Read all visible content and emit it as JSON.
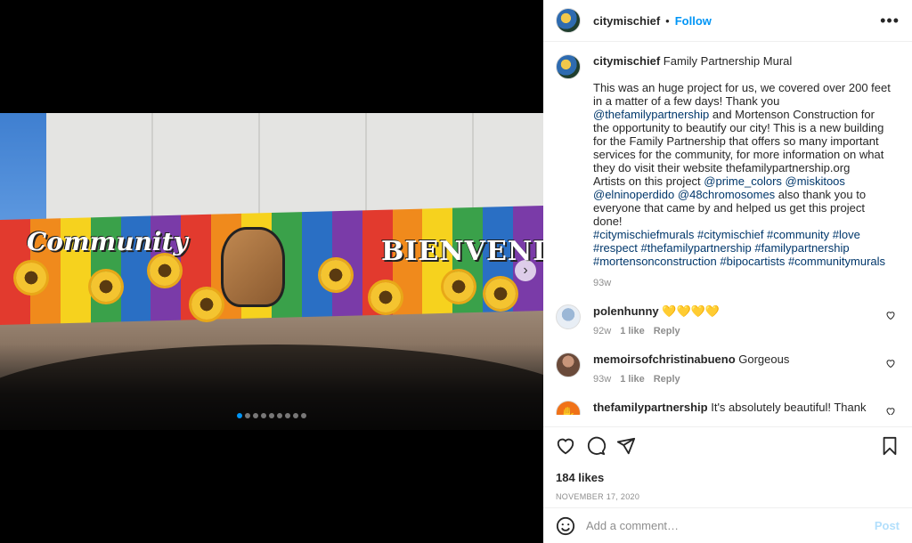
{
  "post": {
    "username": "citymischief",
    "separator": "•",
    "follow_label": "Follow",
    "more_label": "•••"
  },
  "media": {
    "mural_text_left": "Community",
    "mural_text_right": "BIENVENIDOS",
    "stripe_colors": [
      "#e23a2e",
      "#f08a1c",
      "#f6d21e",
      "#3aa14a",
      "#2a6fc4",
      "#7a3ba8",
      "#e23a2e",
      "#f08a1c",
      "#f6d21e",
      "#3aa14a",
      "#2a6fc4",
      "#7a3ba8",
      "#e23a2e",
      "#f08a1c",
      "#f6d21e",
      "#3aa14a",
      "#2a6fc4",
      "#7a3ba8"
    ],
    "next_icon": "chevron-right-icon",
    "next_label": "›",
    "carousel_count": 9,
    "carousel_active": 0
  },
  "caption": {
    "username": "citymischief",
    "title": "Family Partnership Mural",
    "text_1": "This was an huge project for us, we covered over 200 feet in a matter of a few days! Thank you ",
    "mention_1": "@thefamilypartnership",
    "text_2": " and Mortenson Construction for the opportunity to beautify our city! This is a new building for the Family Partnership that offers so many important services for the community, for more information on what they do visit their website thefamilypartnership.org",
    "text_3": "Artists on this project ",
    "mention_2": "@prime_colors",
    "mention_3": "@miskitoos",
    "mention_4": "@elninoperdido",
    "mention_5": "@48chromosomes",
    "text_4": " also thank you to everyone that came by and helped us get this project done!",
    "hashtags_1": "#citymischiefmurals #citymischief #community #love",
    "hashtags_2": "#respect #thefamilypartnership #familypartnership",
    "hashtags_3": "#mortensonconstruction #bipocartists #communitymurals",
    "time": "93w"
  },
  "comments": [
    {
      "username": "polenhunny",
      "text": "💛💛💛💛",
      "time": "92w",
      "likes": "1 like",
      "reply": "Reply"
    },
    {
      "username": "memoirsofchristinabueno",
      "text": "Gorgeous",
      "time": "93w",
      "likes": "1 like",
      "reply": "Reply"
    },
    {
      "username": "thefamilypartnership",
      "text": "It's absolutely beautiful! Thank you so much for your work ❤️",
      "avatar_glyph": "✋"
    }
  ],
  "actions": {
    "likes": "184 likes",
    "date": "NOVEMBER 17, 2020"
  },
  "add_comment": {
    "placeholder": "Add a comment…",
    "post_label": "Post"
  },
  "colors": {
    "accent": "#0095f6",
    "post_disabled": "#b2dffc",
    "link": "#00376b"
  }
}
